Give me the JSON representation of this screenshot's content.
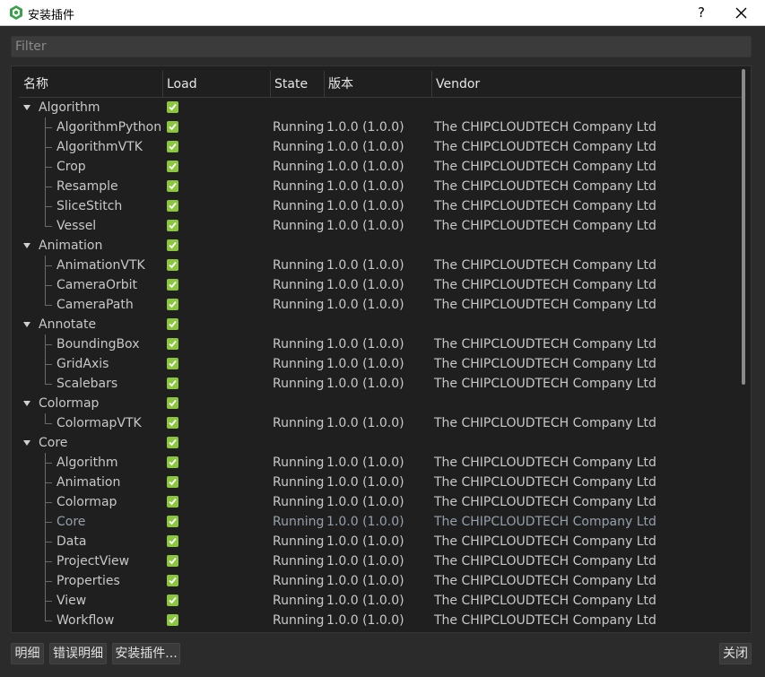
{
  "window": {
    "title": "安装插件",
    "help_label": "?",
    "icon_color": "#3aa04a"
  },
  "filter": {
    "placeholder": "Filter",
    "value": ""
  },
  "columns": [
    "名称",
    "Load",
    "State",
    "版本",
    "Vendor"
  ],
  "groups": [
    {
      "name": "Algorithm",
      "loaded": true,
      "children": [
        {
          "name": "AlgorithmPython",
          "loaded": true,
          "state": "Running",
          "version": "1.0.0 (1.0.0)",
          "vendor": "The CHIPCLOUDTECH Company Ltd"
        },
        {
          "name": "AlgorithmVTK",
          "loaded": true,
          "state": "Running",
          "version": "1.0.0 (1.0.0)",
          "vendor": "The CHIPCLOUDTECH Company Ltd"
        },
        {
          "name": "Crop",
          "loaded": true,
          "state": "Running",
          "version": "1.0.0 (1.0.0)",
          "vendor": "The CHIPCLOUDTECH Company Ltd"
        },
        {
          "name": "Resample",
          "loaded": true,
          "state": "Running",
          "version": "1.0.0 (1.0.0)",
          "vendor": "The CHIPCLOUDTECH Company Ltd"
        },
        {
          "name": "SliceStitch",
          "loaded": true,
          "state": "Running",
          "version": "1.0.0 (1.0.0)",
          "vendor": "The CHIPCLOUDTECH Company Ltd"
        },
        {
          "name": "Vessel",
          "loaded": true,
          "state": "Running",
          "version": "1.0.0 (1.0.0)",
          "vendor": "The CHIPCLOUDTECH Company Ltd"
        }
      ]
    },
    {
      "name": "Animation",
      "loaded": true,
      "children": [
        {
          "name": "AnimationVTK",
          "loaded": true,
          "state": "Running",
          "version": "1.0.0 (1.0.0)",
          "vendor": "The CHIPCLOUDTECH Company Ltd"
        },
        {
          "name": "CameraOrbit",
          "loaded": true,
          "state": "Running",
          "version": "1.0.0 (1.0.0)",
          "vendor": "The CHIPCLOUDTECH Company Ltd"
        },
        {
          "name": "CameraPath",
          "loaded": true,
          "state": "Running",
          "version": "1.0.0 (1.0.0)",
          "vendor": "The CHIPCLOUDTECH Company Ltd"
        }
      ]
    },
    {
      "name": "Annotate",
      "loaded": true,
      "children": [
        {
          "name": "BoundingBox",
          "loaded": true,
          "state": "Running",
          "version": "1.0.0 (1.0.0)",
          "vendor": "The CHIPCLOUDTECH Company Ltd"
        },
        {
          "name": "GridAxis",
          "loaded": true,
          "state": "Running",
          "version": "1.0.0 (1.0.0)",
          "vendor": "The CHIPCLOUDTECH Company Ltd"
        },
        {
          "name": "Scalebars",
          "loaded": true,
          "state": "Running",
          "version": "1.0.0 (1.0.0)",
          "vendor": "The CHIPCLOUDTECH Company Ltd"
        }
      ]
    },
    {
      "name": "Colormap",
      "loaded": true,
      "children": [
        {
          "name": "ColormapVTK",
          "loaded": true,
          "state": "Running",
          "version": "1.0.0 (1.0.0)",
          "vendor": "The CHIPCLOUDTECH Company Ltd"
        }
      ]
    },
    {
      "name": "Core",
      "loaded": true,
      "children": [
        {
          "name": "Algorithm",
          "loaded": true,
          "state": "Running",
          "version": "1.0.0 (1.0.0)",
          "vendor": "The CHIPCLOUDTECH Company Ltd"
        },
        {
          "name": "Animation",
          "loaded": true,
          "state": "Running",
          "version": "1.0.0 (1.0.0)",
          "vendor": "The CHIPCLOUDTECH Company Ltd"
        },
        {
          "name": "Colormap",
          "loaded": true,
          "state": "Running",
          "version": "1.0.0 (1.0.0)",
          "vendor": "The CHIPCLOUDTECH Company Ltd"
        },
        {
          "name": "Core",
          "loaded": true,
          "state": "Running",
          "version": "1.0.0 (1.0.0)",
          "vendor": "The CHIPCLOUDTECH Company Ltd",
          "muted": true
        },
        {
          "name": "Data",
          "loaded": true,
          "state": "Running",
          "version": "1.0.0 (1.0.0)",
          "vendor": "The CHIPCLOUDTECH Company Ltd"
        },
        {
          "name": "ProjectView",
          "loaded": true,
          "state": "Running",
          "version": "1.0.0 (1.0.0)",
          "vendor": "The CHIPCLOUDTECH Company Ltd"
        },
        {
          "name": "Properties",
          "loaded": true,
          "state": "Running",
          "version": "1.0.0 (1.0.0)",
          "vendor": "The CHIPCLOUDTECH Company Ltd"
        },
        {
          "name": "View",
          "loaded": true,
          "state": "Running",
          "version": "1.0.0 (1.0.0)",
          "vendor": "The CHIPCLOUDTECH Company Ltd"
        },
        {
          "name": "Workflow",
          "loaded": true,
          "state": "Running",
          "version": "1.0.0 (1.0.0)",
          "vendor": "The CHIPCLOUDTECH Company Ltd"
        }
      ]
    }
  ],
  "buttons": {
    "details": "明细",
    "error_details": "错误明细",
    "install": "安装插件...",
    "close": "关闭"
  },
  "colors": {
    "checkbox": "#8cc63f",
    "background": "#2b2b2b",
    "tree_bg": "#1f1f1f"
  }
}
